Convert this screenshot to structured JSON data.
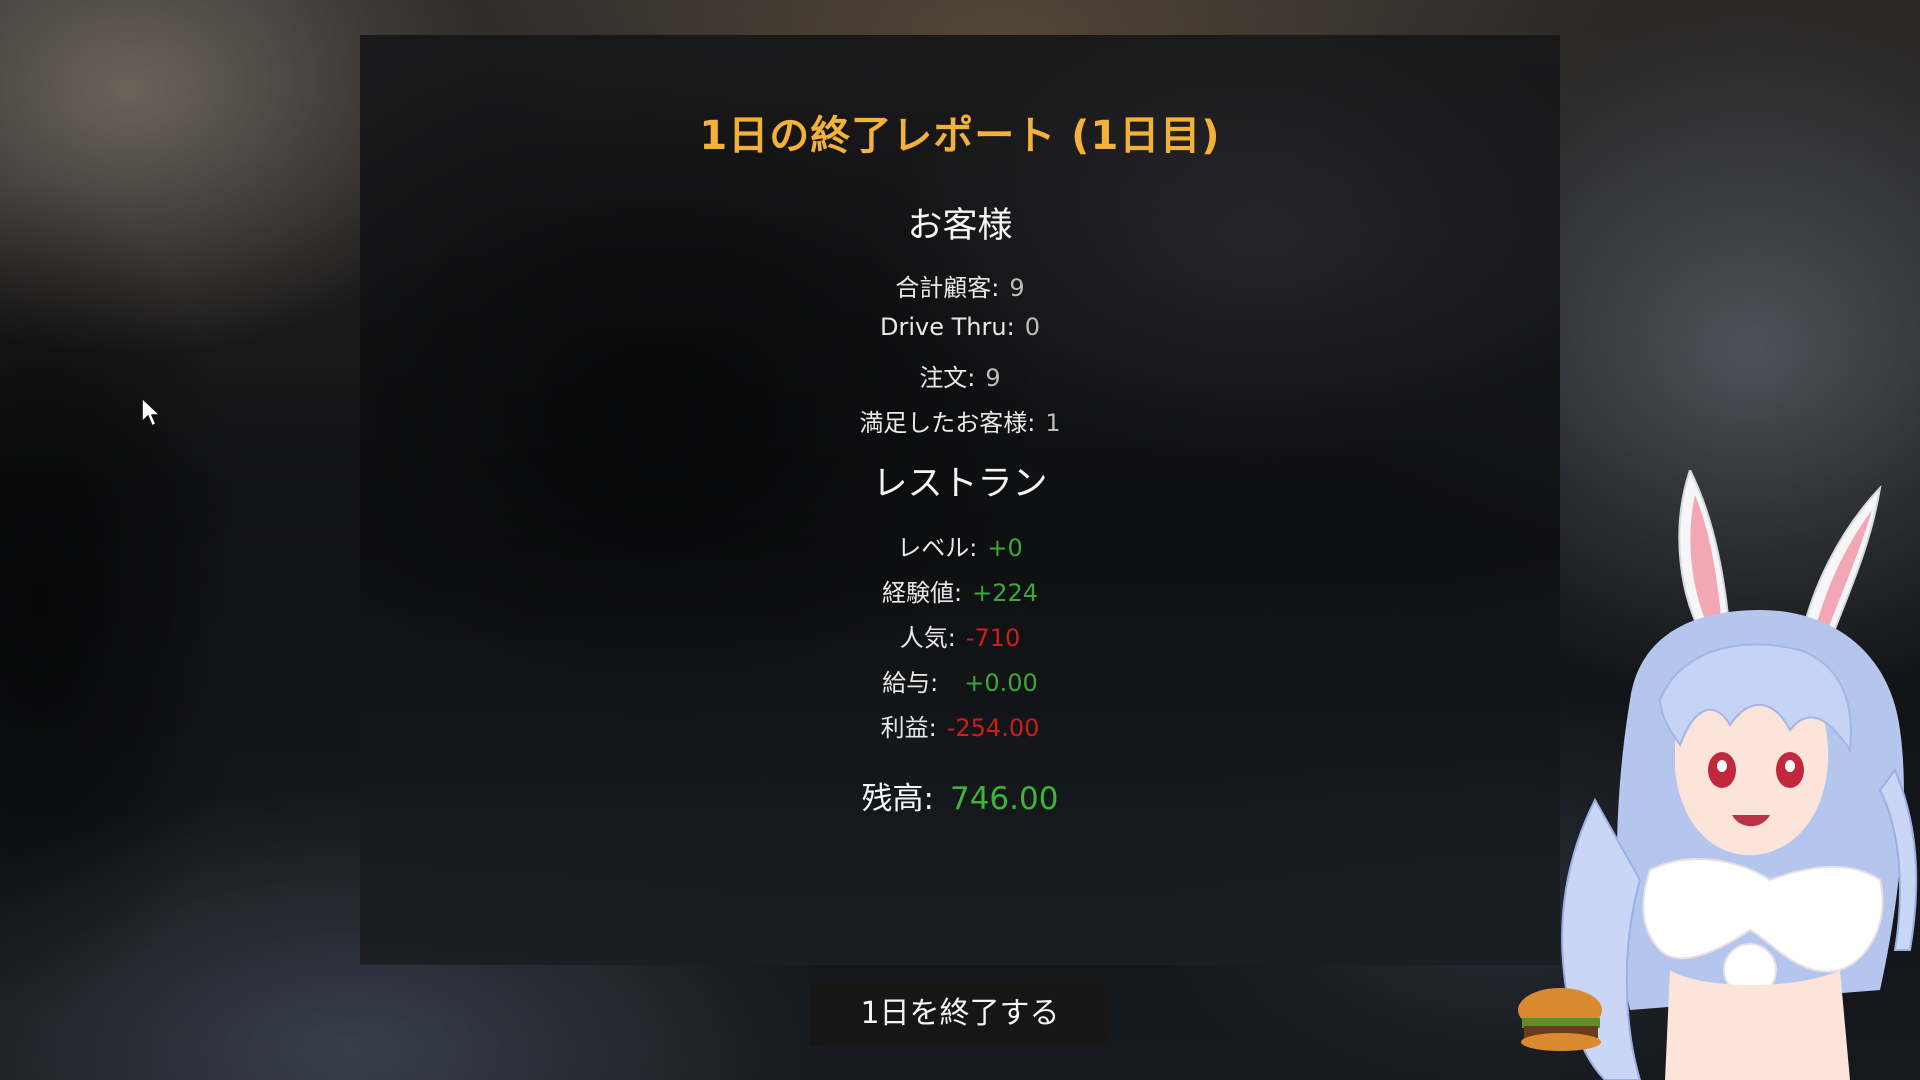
{
  "report": {
    "title": "1日の終了レポート (1日目)"
  },
  "customers": {
    "heading": "お客様",
    "stats": [
      {
        "label": "合計顧客:",
        "value": "9"
      },
      {
        "label": "Drive Thru:",
        "value": "0"
      },
      {
        "label": "注文:",
        "value": "9"
      },
      {
        "label": "満足したお客様:",
        "value": "1"
      }
    ]
  },
  "restaurant": {
    "heading": "レストラン",
    "stats": [
      {
        "label": "レベル:",
        "value": "+0"
      },
      {
        "label": "経験値:",
        "value": "+224"
      },
      {
        "label": "人気:",
        "value": "-710"
      },
      {
        "label": "給与:",
        "value": "+0.00"
      },
      {
        "label": "利益:",
        "value": "-254.00"
      }
    ]
  },
  "balance": {
    "label": "残高:",
    "value": "746.00"
  },
  "end_day_button": {
    "label": "1日を終了する"
  },
  "colors": {
    "title": "#f2b13a",
    "positive": "#3ea63a",
    "negative": "#c91f1f",
    "neutral_value": "#bdbdbd",
    "balance": "#3eb43a"
  },
  "icons": {
    "cursor": "mouse-pointer-icon",
    "character": "bunny-girl-vtuber-avatar"
  }
}
